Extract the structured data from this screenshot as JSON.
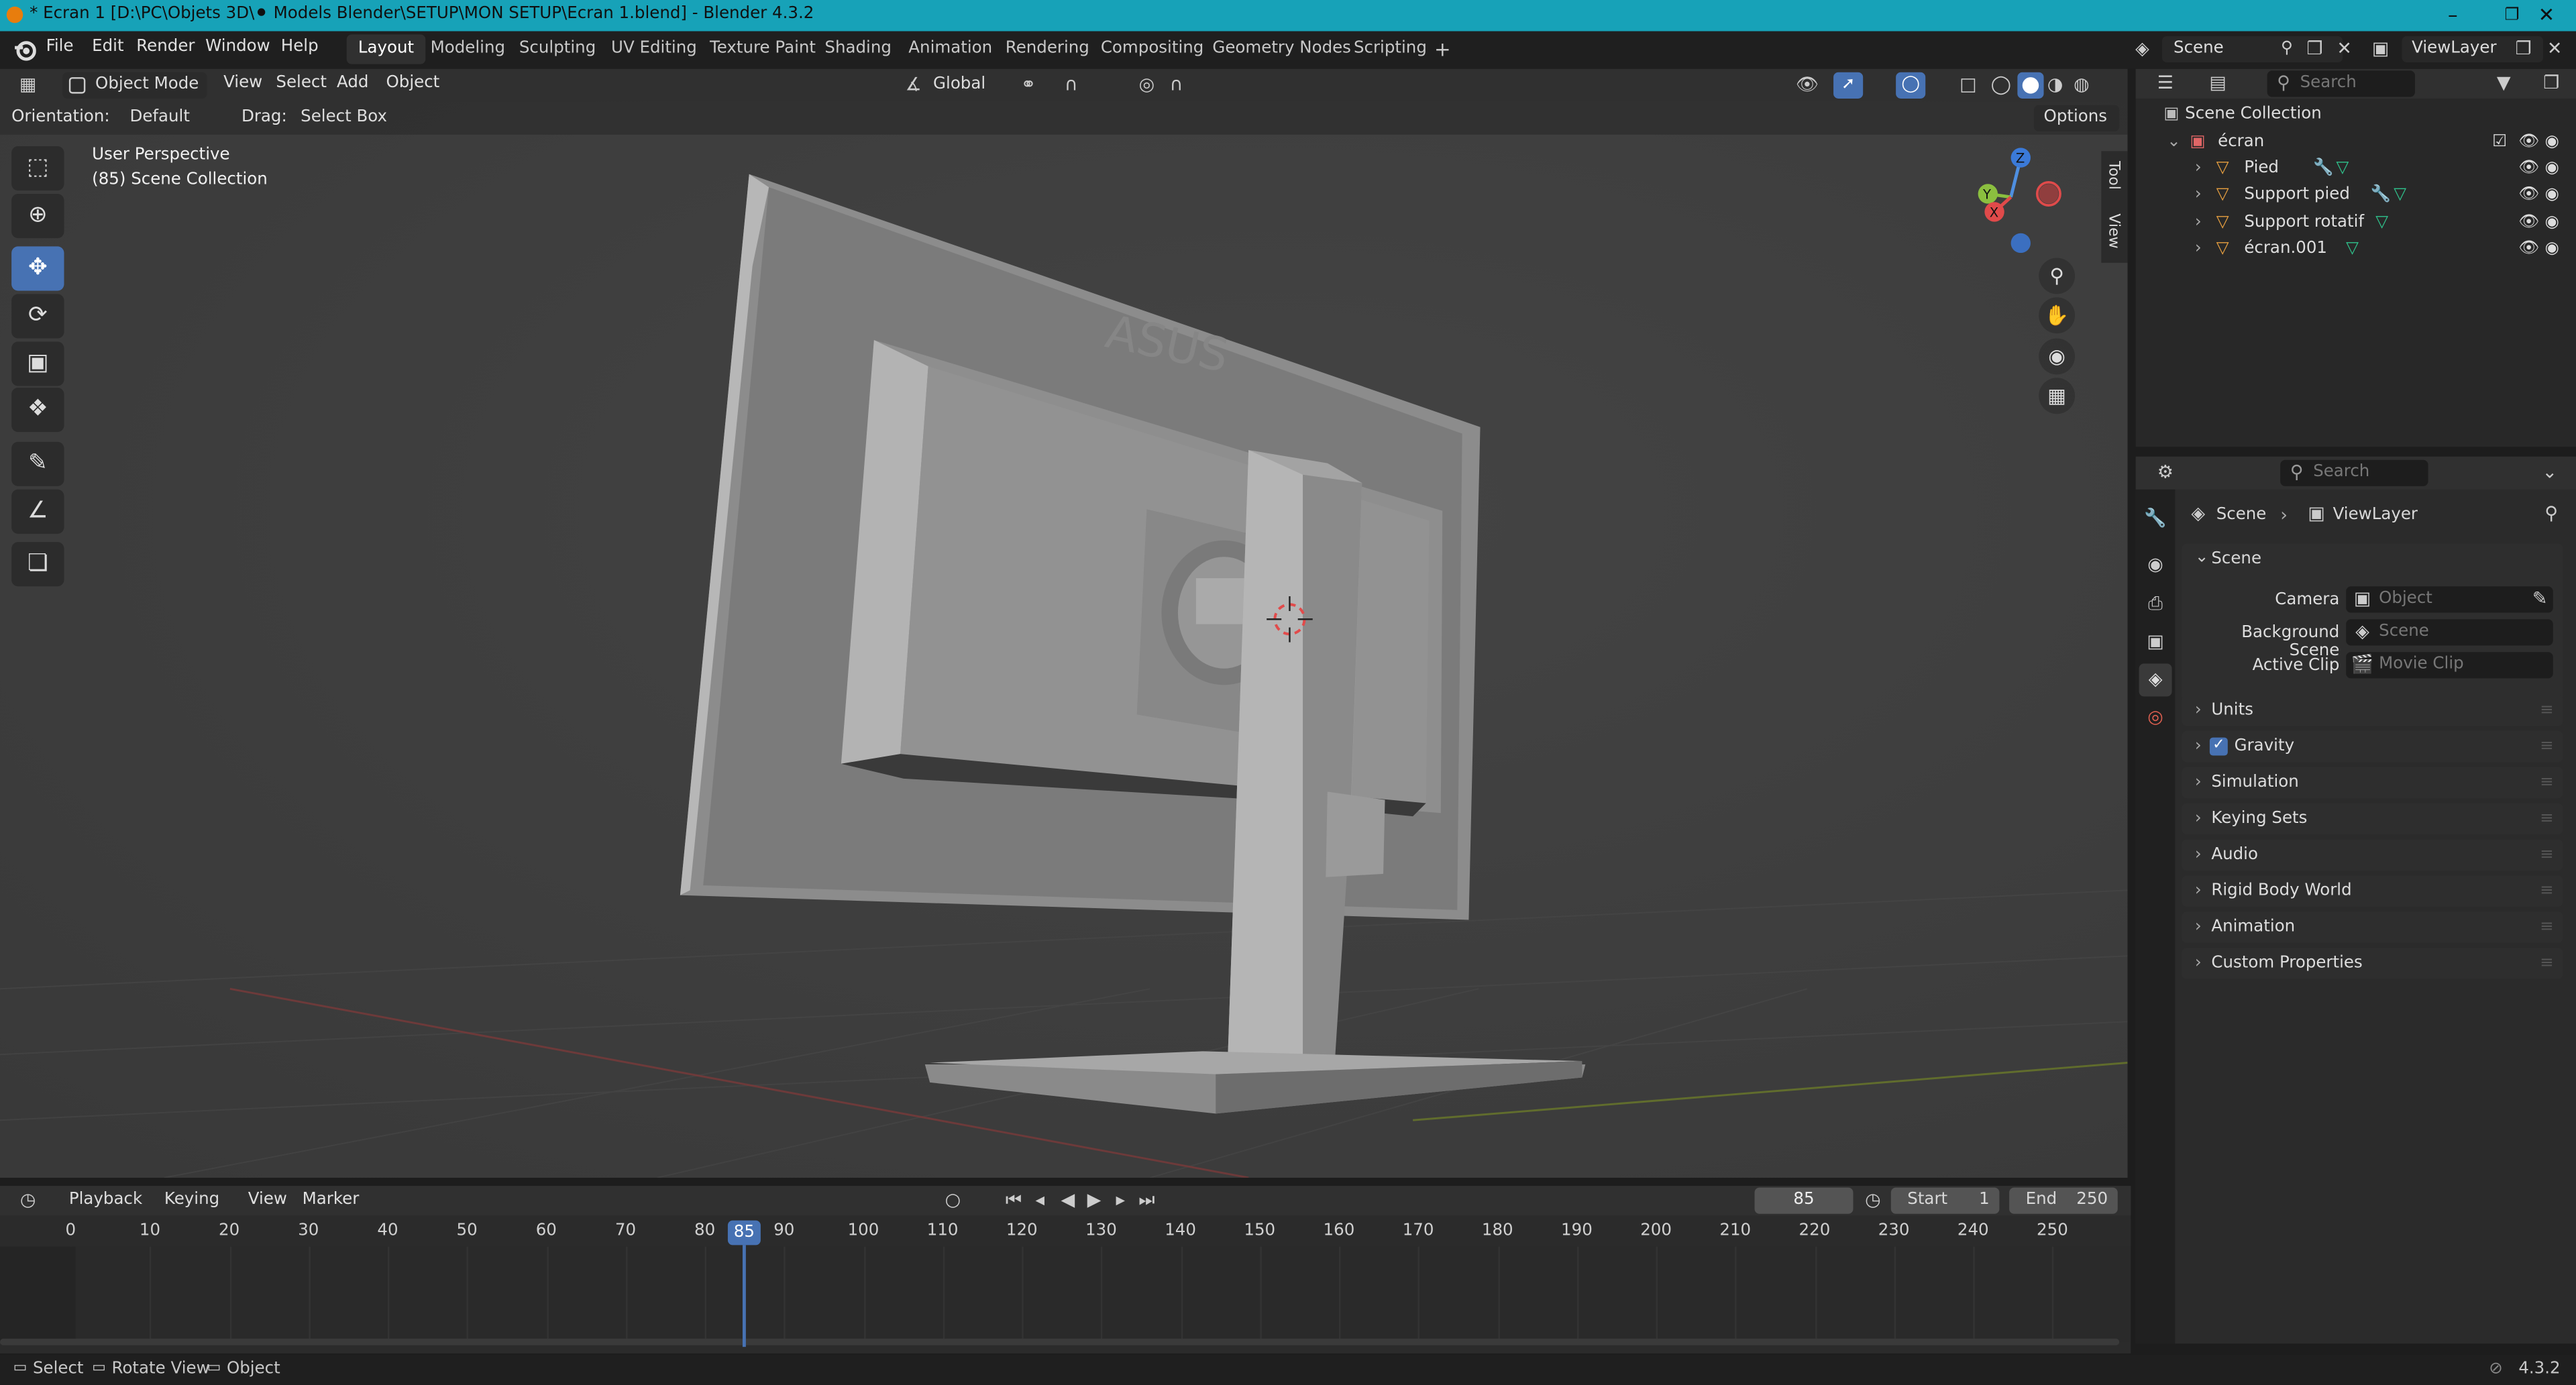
{
  "window": {
    "title": "* Ecran 1 [D:\\PC\\Objets 3D\\⚫ Models Blender\\SETUP\\MON SETUP\\Ecran 1.blend] - Blender 4.3.2",
    "minimize": "–",
    "maximize": "❐",
    "close": "✕"
  },
  "menubar": {
    "items": [
      "File",
      "Edit",
      "Render",
      "Window",
      "Help"
    ]
  },
  "workspaces": {
    "tabs": [
      "Layout",
      "Modeling",
      "Sculpting",
      "UV Editing",
      "Texture Paint",
      "Shading",
      "Animation",
      "Rendering",
      "Compositing",
      "Geometry Nodes",
      "Scripting"
    ],
    "active": "Layout",
    "add": "+"
  },
  "scene_selector": {
    "scene": "Scene",
    "view_layer": "ViewLayer"
  },
  "viewport_header": {
    "mode": "Object Mode",
    "menus": [
      "View",
      "Select",
      "Add",
      "Object"
    ],
    "transform_orientation": "Global"
  },
  "tool_settings": {
    "orientation_label": "Orientation:",
    "orientation_value": "Default",
    "drag_label": "Drag:",
    "drag_value": "Select Box",
    "options": "Options"
  },
  "viewport": {
    "perspective": "User Perspective",
    "collection": "(85) Scene Collection",
    "side_tabs": [
      "Tool",
      "View"
    ],
    "gizmo": {
      "x": "X",
      "y": "Y",
      "z": "Z"
    },
    "background": "#3d3d3d"
  },
  "toolbar": {
    "tools": [
      "select-box",
      "cursor",
      "move",
      "rotate",
      "scale",
      "transform",
      "annotate",
      "measure",
      "add-cube"
    ],
    "active": "move"
  },
  "outliner": {
    "search_placeholder": "Search",
    "root": "Scene Collection",
    "collection": "écran",
    "objects": [
      "Pied",
      "Support pied",
      "Support rotatif",
      "écran.001"
    ]
  },
  "properties": {
    "search_placeholder": "Search",
    "breadcrumb": {
      "scene": "Scene",
      "view_layer": "ViewLayer"
    },
    "scene_panel": "Scene",
    "fields": {
      "camera_label": "Camera",
      "camera_placeholder": "Object",
      "background_scene_label": "Background Scene",
      "background_scene_placeholder": "Scene",
      "active_clip_label": "Active Clip",
      "active_clip_placeholder": "Movie Clip"
    },
    "panels": [
      "Units",
      "Gravity",
      "Simulation",
      "Keying Sets",
      "Audio",
      "Rigid Body World",
      "Animation",
      "Custom Properties"
    ],
    "gravity_enabled": true
  },
  "timeline": {
    "menus": [
      "Playback",
      "Keying",
      "View",
      "Marker"
    ],
    "current_frame": "85",
    "start_label": "Start",
    "start": "1",
    "end_label": "End",
    "end": "250",
    "ticks": [
      "0",
      "10",
      "20",
      "30",
      "40",
      "50",
      "60",
      "70",
      "80",
      "90",
      "100",
      "110",
      "120",
      "130",
      "140",
      "150",
      "160",
      "170",
      "180",
      "190",
      "200",
      "210",
      "220",
      "230",
      "240",
      "250"
    ],
    "playhead_label": "85",
    "playhead_color": "#4772b3"
  },
  "statusbar": {
    "items": [
      "Select",
      "Rotate View",
      "Object"
    ],
    "version": "4.3.2"
  },
  "colors": {
    "titlebar": "#17a2b8",
    "accent": "#4772b3",
    "collection_icon": "#e06666",
    "object_icon": "#e8a040",
    "mesh_icon": "#2fc48d",
    "modifier_icon": "#5d9de0"
  }
}
